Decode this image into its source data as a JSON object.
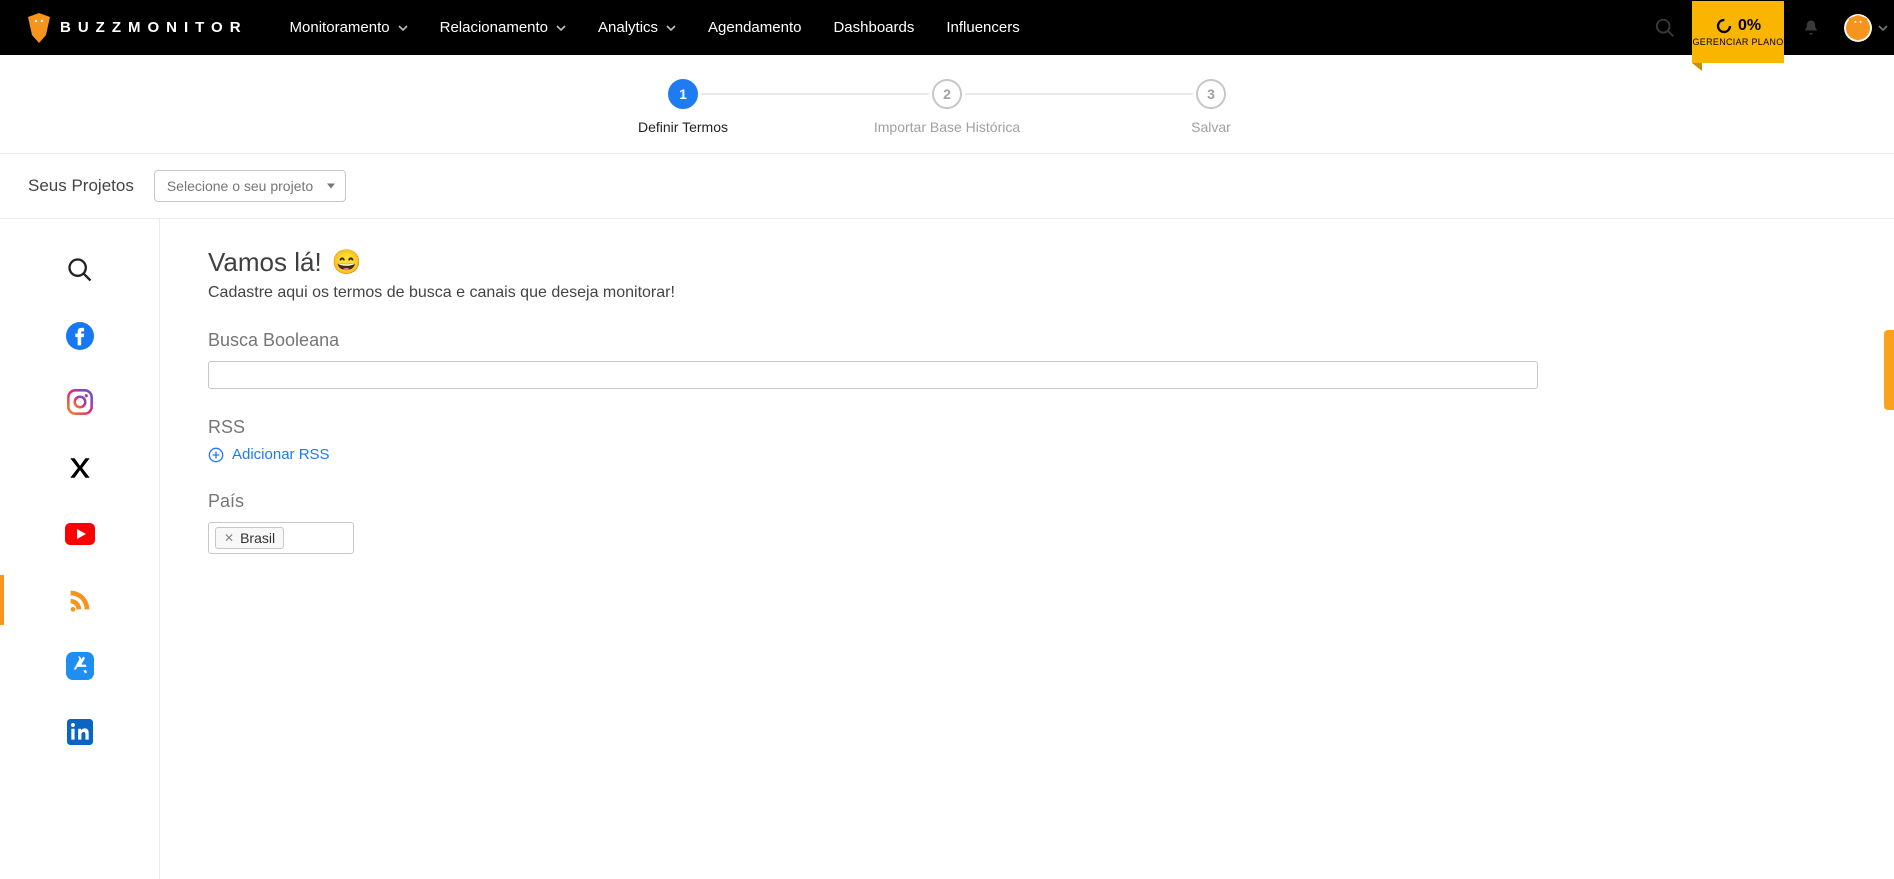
{
  "brand": {
    "name": "BUZZMONITOR"
  },
  "nav": {
    "items": [
      {
        "label": "Monitoramento",
        "has_chevron": true
      },
      {
        "label": "Relacionamento",
        "has_chevron": true
      },
      {
        "label": "Analytics",
        "has_chevron": true
      },
      {
        "label": "Agendamento",
        "has_chevron": false
      },
      {
        "label": "Dashboards",
        "has_chevron": false
      },
      {
        "label": "Influencers",
        "has_chevron": false
      }
    ]
  },
  "plan": {
    "percent": "0%",
    "manage_label": "GERENCIAR PLANO"
  },
  "stepper": {
    "steps": [
      {
        "num": "1",
        "label": "Definir Termos",
        "active": true
      },
      {
        "num": "2",
        "label": "Importar Base Histórica",
        "active": false
      },
      {
        "num": "3",
        "label": "Salvar",
        "active": false
      }
    ]
  },
  "project_row": {
    "label": "Seus Projetos",
    "placeholder": "Selecione o seu projeto"
  },
  "rail": {
    "items": [
      {
        "icon": "search-icon"
      },
      {
        "icon": "facebook-icon"
      },
      {
        "icon": "instagram-icon"
      },
      {
        "icon": "twitter-x-icon"
      },
      {
        "icon": "youtube-icon"
      },
      {
        "icon": "rss-icon",
        "active": true
      },
      {
        "icon": "appstore-icon"
      },
      {
        "icon": "linkedin-icon"
      }
    ]
  },
  "content": {
    "title": "Vamos lá!",
    "emoji": "😄",
    "subtitle": "Cadastre aqui os termos de busca e canais que deseja monitorar!",
    "sections": {
      "boolean": {
        "label": "Busca Booleana",
        "value": ""
      },
      "rss": {
        "label": "RSS",
        "add_label": "Adicionar RSS"
      },
      "pais": {
        "label": "País",
        "tags": [
          "Brasil"
        ]
      }
    }
  },
  "colors": {
    "accent_orange": "#f7941d",
    "plan_yellow": "#f9b500",
    "step_blue": "#1e7bf2",
    "link_blue": "#1e7bf2"
  }
}
